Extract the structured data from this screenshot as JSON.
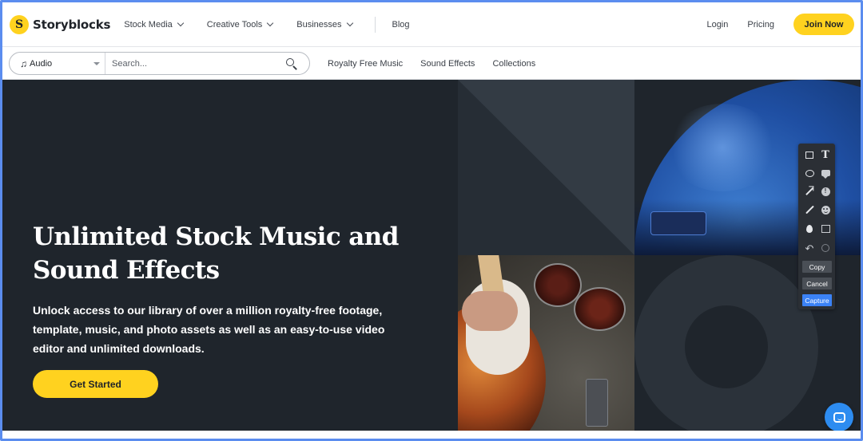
{
  "brand": {
    "name": "Storyblocks",
    "logo_glyph": "S",
    "accent": "#ffd21f"
  },
  "topnav": {
    "items": [
      {
        "label": "Stock Media"
      },
      {
        "label": "Creative Tools"
      },
      {
        "label": "Businesses"
      }
    ],
    "blog": "Blog",
    "login": "Login",
    "pricing": "Pricing",
    "join": "Join Now"
  },
  "search": {
    "type_icon": "music-note-icon",
    "type_value": "Audio",
    "placeholder": "Search...",
    "links": [
      {
        "label": "Royalty Free Music"
      },
      {
        "label": "Sound Effects"
      },
      {
        "label": "Collections"
      }
    ]
  },
  "hero": {
    "title": "Unlimited Stock Music and Sound Effects",
    "subtitle": "Unlock access to our library of over a million royalty-free footage, template, music, and photo assets as well as an easy-to-use video editor and unlimited downloads.",
    "cta": "Get Started"
  },
  "capture_toolbar": {
    "tools": [
      "rectangle-icon",
      "text-icon",
      "ellipse-icon",
      "speech-bubble-icon",
      "arrow-icon",
      "info-icon",
      "line-icon",
      "emoji-icon",
      "blur-drop-icon",
      "image-insert-icon",
      "undo-icon",
      "redo-icon"
    ],
    "copy": "Copy",
    "cancel": "Cancel",
    "capture": "Capture",
    "capture_color": "#3b82f6"
  },
  "chat": {
    "icon": "chat-icon",
    "color": "#2d8cf0"
  }
}
